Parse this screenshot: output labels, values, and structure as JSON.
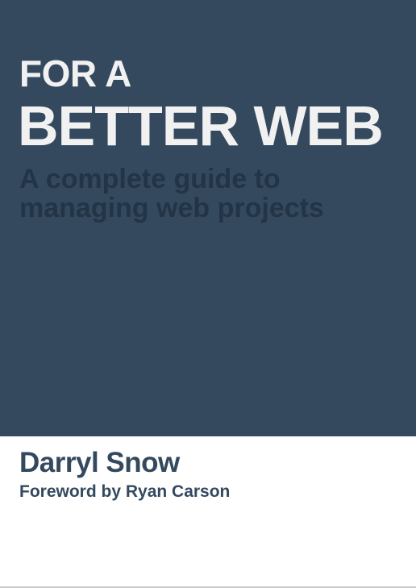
{
  "cover": {
    "title_line_1": "FOR A",
    "title_line_2": "BETTER WEB",
    "subtitle_line_1": "A complete guide to",
    "subtitle_line_2": "managing web projects",
    "author": "Darryl Snow",
    "foreword": "Foreword by Ryan Carson"
  },
  "colors": {
    "panel_background": "#34495e",
    "title_text": "#f1f1f1",
    "subtitle_text": "#233446",
    "author_text": "#34495e",
    "page_background": "#ffffff"
  }
}
